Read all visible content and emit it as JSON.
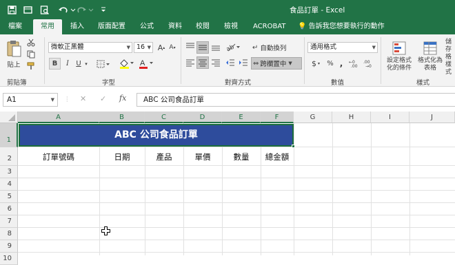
{
  "window": {
    "title": "食品訂單 - Excel",
    "quick_access": [
      "save-icon",
      "touch-mode-icon",
      "print-preview-icon",
      "undo-icon",
      "redo-icon",
      "customize-qat-icon"
    ]
  },
  "tabs": [
    {
      "label": "檔案"
    },
    {
      "label": "常用",
      "active": true
    },
    {
      "label": "插入"
    },
    {
      "label": "版面配置"
    },
    {
      "label": "公式"
    },
    {
      "label": "資料"
    },
    {
      "label": "校閱"
    },
    {
      "label": "檢視"
    },
    {
      "label": "ACROBAT"
    }
  ],
  "tell_me": "告訴我您想要執行的動作",
  "ribbon": {
    "clipboard": {
      "paste": "貼上",
      "group": "剪貼簿"
    },
    "font": {
      "font_name": "微軟正黑體",
      "font_size": "16",
      "bold": "B",
      "italic": "I",
      "underline": "U",
      "group": "字型",
      "grow": "A",
      "shrink": "A"
    },
    "alignment": {
      "wrap_text": "自動換列",
      "merge_center": "跨欄置中",
      "group": "對齊方式"
    },
    "number": {
      "format": "通用格式",
      "currency": "$",
      "percent": "%",
      "comma": ",",
      "group": "數值"
    },
    "styles": {
      "conditional": "設定格式化的條件",
      "format_table": "格式化為表格",
      "cell_styles": "儲存格樣式",
      "group": "樣式"
    }
  },
  "formula_bar": {
    "name_box": "A1",
    "cancel": "✕",
    "enter": "✓",
    "fx": "fx",
    "content": "ABC 公司食品訂單"
  },
  "columns": [
    "A",
    "B",
    "C",
    "D",
    "E",
    "F",
    "G",
    "H",
    "I",
    "J"
  ],
  "rows": [
    "1",
    "2",
    "3",
    "4",
    "5",
    "6",
    "7",
    "8",
    "9",
    "10"
  ],
  "sheet": {
    "title": "ABC 公司食品訂單",
    "headers": [
      "訂單號碼",
      "日期",
      "產品",
      "單價",
      "數量",
      "總金額"
    ]
  },
  "colors": {
    "excel_green": "#217346",
    "banner_fill": "#2e4c9c"
  }
}
